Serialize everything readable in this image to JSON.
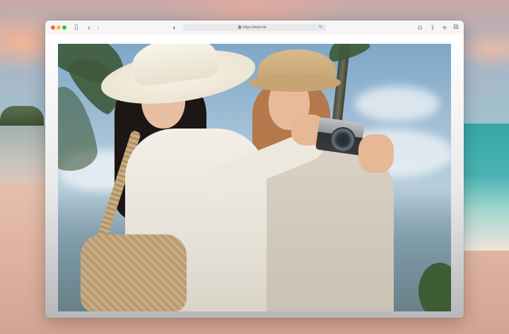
{
  "browser": {
    "url": "https://www.de"
  },
  "icons": {
    "sidebar": "sidebar-icon",
    "back": "chevron-left-icon",
    "forward": "chevron-right-icon",
    "privacy": "shield-icon",
    "lock": "lock-icon",
    "reload": "reload-icon",
    "downloads": "download-icon",
    "share": "share-icon",
    "new_tab": "plus-icon",
    "tab_overview": "tabs-icon"
  },
  "glyphs": {
    "sidebar": "▯",
    "back": "‹",
    "forward": "›",
    "privacy": "◐",
    "reload": "↻",
    "downloads": "⊙",
    "share": "⇪",
    "new_tab": "+",
    "tab_overview": "⧉"
  },
  "colors": {
    "close": "#ff5f57",
    "minimize": "#febc2e",
    "maximize": "#28c840",
    "toolbar": "#f6f6f6"
  }
}
